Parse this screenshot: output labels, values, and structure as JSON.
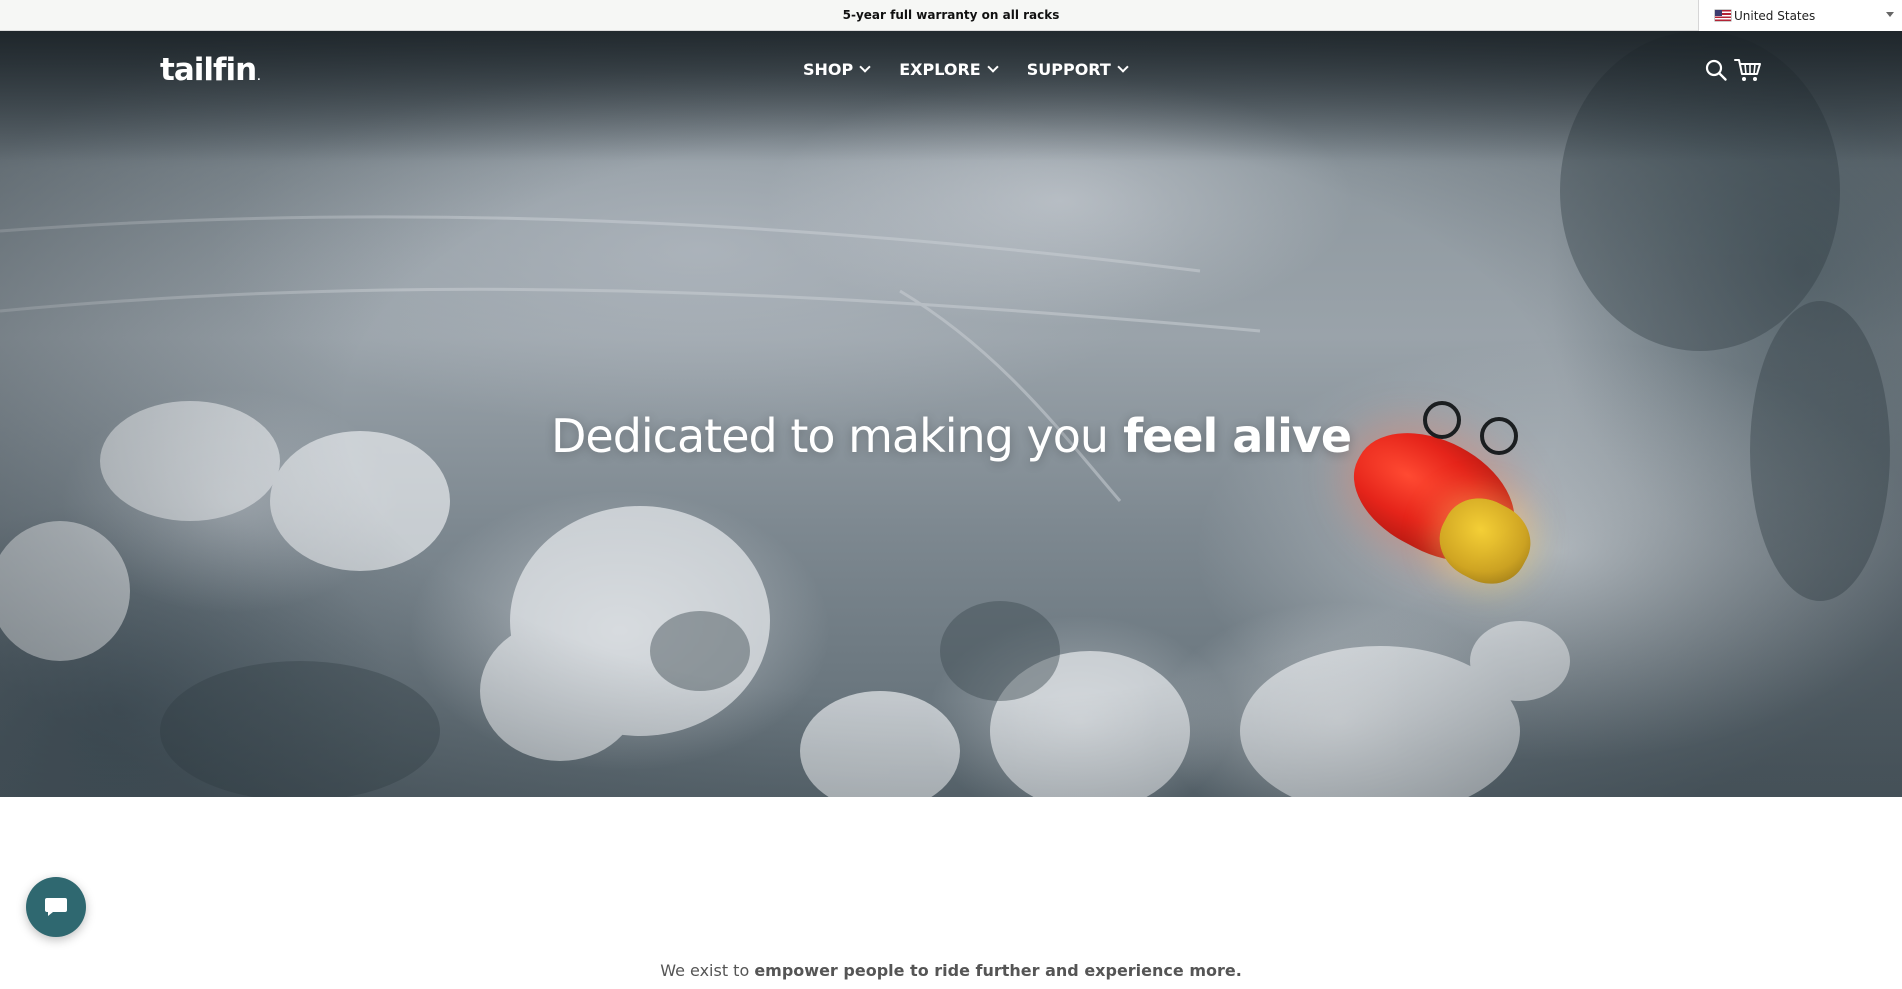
{
  "announcement": {
    "text": "5-year full warranty on all racks"
  },
  "country_selector": {
    "flag_icon": "us-flag-icon",
    "label": "United States"
  },
  "header": {
    "logo_text": "tailfin",
    "logo_mark": ".",
    "nav": [
      {
        "label": "SHOP",
        "icon": "chevron-down-icon"
      },
      {
        "label": "EXPLORE",
        "icon": "chevron-down-icon"
      },
      {
        "label": "SUPPORT",
        "icon": "chevron-down-icon"
      }
    ],
    "icons": [
      "search-icon",
      "cart-icon"
    ]
  },
  "hero": {
    "headline_light": "Dedicated to making you",
    "headline_bold": "feel alive"
  },
  "intro": {
    "lead": "We exist to",
    "emphasis": "empower people to ride further and experience more."
  },
  "chat": {
    "icon": "chat-bubble-icon"
  },
  "colors": {
    "chat_button": "#2f6870",
    "text_white": "#ffffff",
    "announce_bg": "#f6f7f5"
  }
}
